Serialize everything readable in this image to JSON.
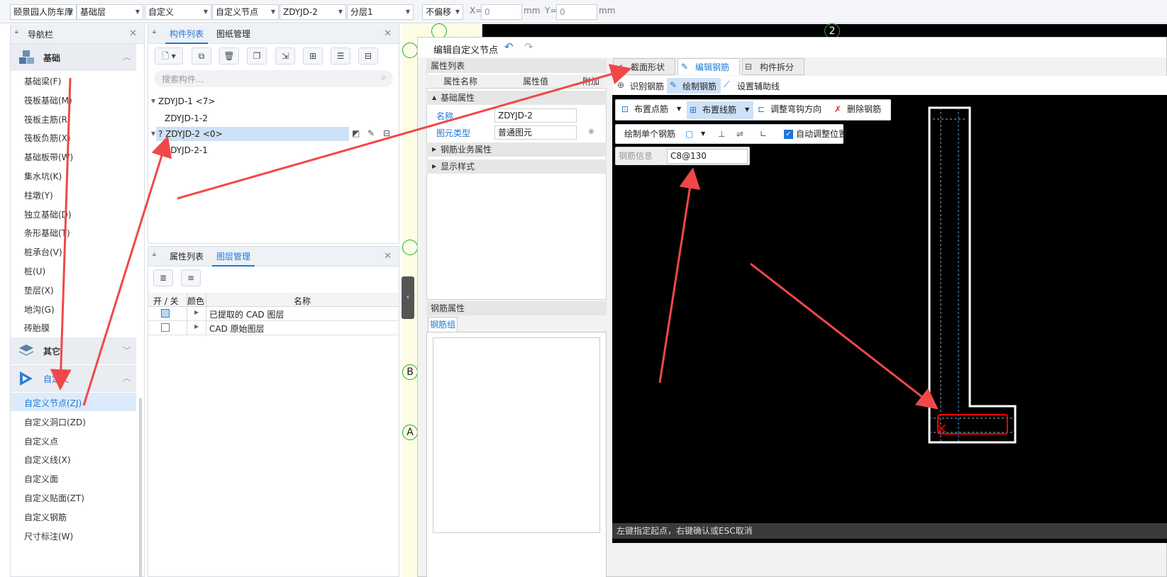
{
  "toolbar": {
    "project": "颐景园人防车库",
    "floor": "基础层",
    "category": "自定义",
    "subtype": "自定义节点",
    "element": "ZDYJD-2",
    "layer": "分层1",
    "offset": "不偏移",
    "x_label": "X=",
    "x_value": "0",
    "y_label": "Y=",
    "y_value": "0",
    "unit": "mm"
  },
  "nav": {
    "title": "导航栏",
    "group_foundation": "基础",
    "foundation_items": [
      "基础梁(F)",
      "筏板基础(M)",
      "筏板主筋(R)",
      "筏板负筋(X)",
      "基础板带(W)",
      "集水坑(K)",
      "柱墩(Y)",
      "独立基础(D)",
      "条形基础(T)",
      "桩承台(V)",
      "桩(U)",
      "垫层(X)",
      "地沟(G)",
      "砖胎膜"
    ],
    "group_other": "其它",
    "group_custom": "自定义",
    "custom_items": [
      "自定义节点(ZJ)",
      "自定义洞口(ZD)",
      "自定义点",
      "自定义线(X)",
      "自定义面",
      "自定义贴面(ZT)",
      "自定义钢筋",
      "尺寸标注(W)"
    ]
  },
  "components": {
    "tab_list": "构件列表",
    "tab_drawings": "图纸管理",
    "search_placeholder": "搜索构件...",
    "tree": [
      "ZDYJD-1 <7>",
      "ZDYJD-1-2",
      "? ZDYJD-2 <0>",
      "ZDYJD-2-1"
    ]
  },
  "layers": {
    "tab_props": "属性列表",
    "tab_layers": "图层管理",
    "col_onoff": "开 / 关",
    "col_color": "颜色",
    "col_name": "名称",
    "rows": [
      "已提取的 CAD 图层",
      "CAD 原始图层"
    ]
  },
  "canvas_axis": {
    "top_num": "2",
    "b": "B",
    "a": "A"
  },
  "dialog": {
    "title": "编辑自定义节点",
    "prop_header": "属性列表",
    "col_name": "属性名称",
    "col_value": "属性值",
    "col_extra": "附加",
    "section_basic": "基础属性",
    "name_label": "名称",
    "name_value": "ZDYJD-2",
    "type_label": "图元类型",
    "type_value": "普通图元",
    "section_business": "钢筋业务属性",
    "section_display": "显示样式",
    "rebar_attr_header": "钢筋属性",
    "rebar_group_tab": "钢筋组",
    "tab_section": "截面形状",
    "tab_edit_rebar": "编辑钢筋",
    "tab_split": "构件拆分",
    "tool_identify": "识别钢筋",
    "tool_draw": "绘制钢筋",
    "tool_aux": "设置辅助线",
    "btn_point": "布置点筋",
    "btn_line": "布置线筋",
    "btn_hook": "调整弯钩方向",
    "btn_delete": "删除钢筋",
    "btn_single": "绘制单个钢筋",
    "auto_adjust": "自动调整位置",
    "rebar_info_label": "钢筋信息",
    "rebar_info_value": "C8@130",
    "status": "左键指定起点，右键确认或ESC取消"
  }
}
